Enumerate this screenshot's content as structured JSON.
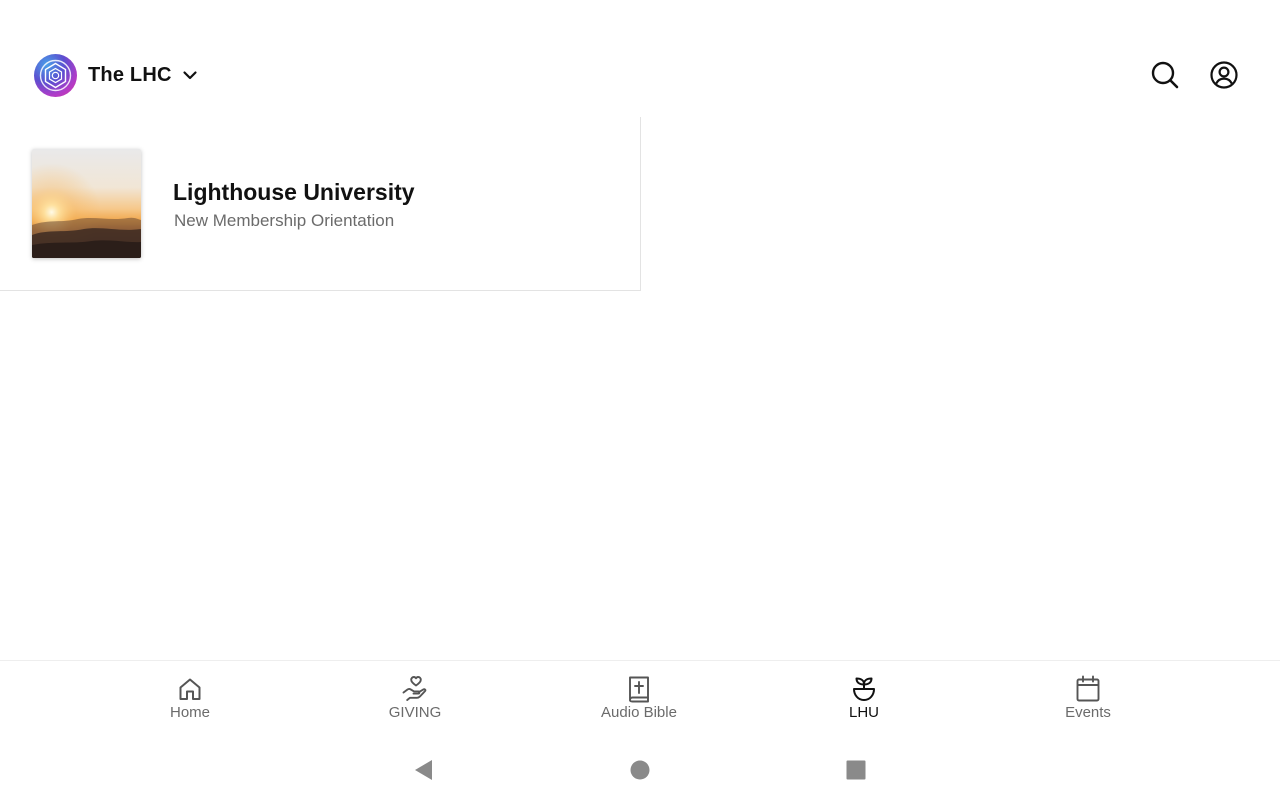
{
  "header": {
    "org_name": "The LHC",
    "org_logo_icon": "lhc-logo-icon",
    "switcher_icon": "chevron-down-icon",
    "search_icon": "search-icon",
    "profile_icon": "account-circle-icon"
  },
  "list": {
    "items": [
      {
        "title": "Lighthouse University",
        "subtitle": "New Membership Orientation",
        "thumbnail": "sunrise-over-clouds-image"
      }
    ]
  },
  "bottom_nav": {
    "items": [
      {
        "label": "Home",
        "icon": "home-icon",
        "active": false
      },
      {
        "label": "GIVING",
        "icon": "hand-heart-icon",
        "active": false
      },
      {
        "label": "Audio Bible",
        "icon": "bible-icon",
        "active": false
      },
      {
        "label": "LHU",
        "icon": "sprout-pot-icon",
        "active": true
      },
      {
        "label": "Events",
        "icon": "calendar-icon",
        "active": false
      }
    ]
  },
  "system_nav": {
    "back_icon": "back-triangle-icon",
    "home_icon": "home-circle-icon",
    "recents_icon": "recents-square-icon"
  },
  "colors": {
    "text_primary": "#111111",
    "text_secondary": "#6b6b6b",
    "divider": "#e3e3e3",
    "system_buttons": "#8a8a8a"
  }
}
